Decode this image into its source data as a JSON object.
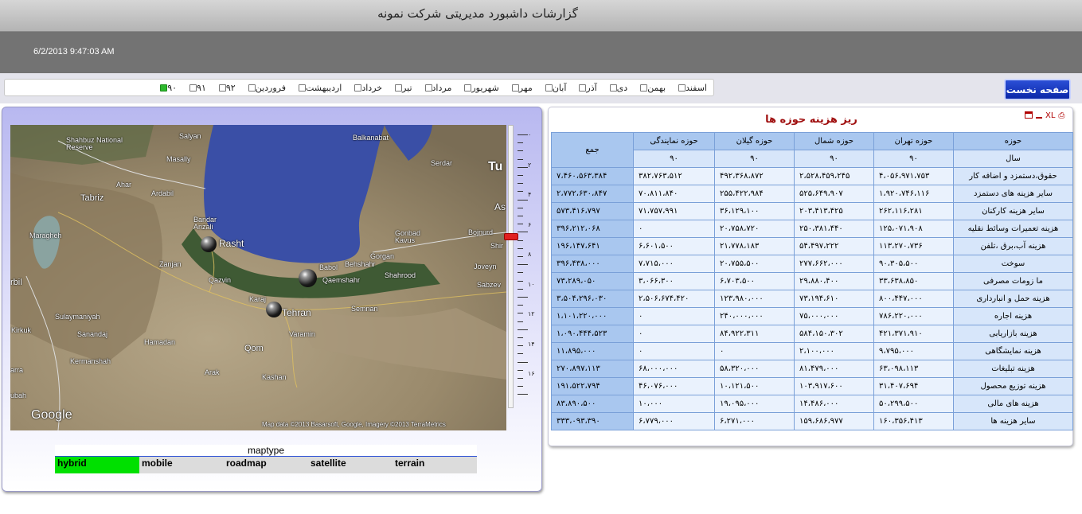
{
  "header": {
    "title": "گزارشات داشبورد مدیریتی شرکت نمونه",
    "datetime": "6/2/2013 9:47:03 AM"
  },
  "toolbar": {
    "home_button": "صفحه نخست",
    "months": [
      {
        "label": "اسفند",
        "checked": false
      },
      {
        "label": "بهمن",
        "checked": false
      },
      {
        "label": "دی",
        "checked": false
      },
      {
        "label": "آذر",
        "checked": false
      },
      {
        "label": "آبان",
        "checked": false
      },
      {
        "label": "مهر",
        "checked": false
      },
      {
        "label": "شهریور",
        "checked": false
      },
      {
        "label": "مرداد",
        "checked": false
      },
      {
        "label": "تیر",
        "checked": false
      },
      {
        "label": "خرداد",
        "checked": false
      },
      {
        "label": "اردیبهشت",
        "checked": false
      },
      {
        "label": "فروردین",
        "checked": false
      },
      {
        "label": "۹۲",
        "checked": false
      },
      {
        "label": "۹۱",
        "checked": false
      },
      {
        "label": "۹۰",
        "checked": true
      }
    ]
  },
  "map": {
    "labels": {
      "shahbuz": "Shahbuz National Reserve",
      "salyan": "Salyan",
      "masally": "Masally",
      "balkanabat": "Balkanabat",
      "serdar": "Serdar",
      "tu": "Tu",
      "ahar": "Ahar",
      "tabriz": "Tabriz",
      "ardabil": "Ardabil",
      "bandar": "Bandar Anzali",
      "rasht": "Rasht",
      "maragheh": "Maragheh",
      "gonbad": "Gonbad Kavus",
      "bojnurd": "Bojnurd",
      "zanjan": "Zanjan",
      "qazvin": "Qazvin",
      "babol": "Babol",
      "behshahr": "Behshahr",
      "gorgan": "Gorgan",
      "qaemshahr": "Qaemshahr",
      "shahrood": "Shahrood",
      "joveyn": "Joveyn",
      "sabzev": "Sabzev",
      "karaj": "Karaj",
      "tehran": "Tehran",
      "semnan": "Semnan",
      "varamin": "Varamin",
      "sulaymaniyah": "Sulaymaniyah",
      "kirkuk": "Kirkuk",
      "sanandaj": "Sanandaj",
      "hamadan": "Hamadan",
      "qom": "Qom",
      "kermanshah": "Kermanshah",
      "arak": "Arak",
      "kashan": "Kashan",
      "as": "As",
      "shir": "Shir",
      "rbil": "rbil",
      "arra": "arra",
      "ubah": "ubah",
      "google": "Google",
      "attribution": "Map data ©2013 Basarsoft, Google, Imagery ©2013 TerraMetrics"
    },
    "zoom_ticks": [
      "۰",
      "۲",
      "۴",
      "۶",
      "۸",
      "۱۰",
      "۱۲",
      "۱۴",
      "۱۶"
    ],
    "maptype": {
      "title": "maptype",
      "options": [
        "hybrid",
        "mobile",
        "roadmap",
        "satellite",
        "terrain"
      ],
      "selected": "hybrid"
    }
  },
  "table": {
    "title": "ریز هزینه حوزه ها",
    "icons": [
      "window-icon",
      "minimize-icon",
      "excel-icon",
      "print-icon"
    ],
    "header_area": "حوزه",
    "header_year": "سال",
    "header_total": "جمع",
    "columns": [
      "حوزه تهران",
      "حوزه شمال",
      "حوزه گیلان",
      "حوزه نمایندگی"
    ],
    "years": [
      "۹۰",
      "۹۰",
      "۹۰",
      "۹۰"
    ],
    "rows": [
      {
        "label": "حقوق،دستمزد و اضافه کار",
        "values": [
          "۴،۰۵۶،۹۷۱،۷۵۳",
          "۲،۵۲۸،۴۵۹،۲۴۵",
          "۴۹۲،۳۶۸،۸۷۲",
          "۳۸۲،۷۶۳،۵۱۲"
        ],
        "total": "۷،۴۶۰،۵۶۳،۳۸۴"
      },
      {
        "label": "سایر هزینه های دستمزد",
        "values": [
          "۱،۹۲۰،۷۴۶،۱۱۶",
          "۵۲۵،۶۴۹،۹۰۷",
          "۲۵۵،۴۲۲،۹۸۴",
          "۷۰،۸۱۱،۸۴۰"
        ],
        "total": "۲،۷۷۲،۶۳۰،۸۴۷"
      },
      {
        "label": "سایر هزینه کارکنان",
        "values": [
          "۲۶۲،۱۱۶،۲۸۱",
          "۲۰۳،۴۱۳،۴۲۵",
          "۳۶،۱۲۹،۱۰۰",
          "۷۱،۷۵۷،۹۹۱"
        ],
        "total": "۵۷۳،۴۱۶،۷۹۷"
      },
      {
        "label": "هزینه تعمیرات وسائط نقلیه",
        "values": [
          "۱۲۵،۰۷۱،۹۰۸",
          "۲۵۰،۳۸۱،۴۴۰",
          "۲۰،۷۵۸،۷۲۰",
          "۰"
        ],
        "total": "۳۹۶،۲۱۲،۰۶۸"
      },
      {
        "label": "هزینه آب،برق ،تلفن",
        "values": [
          "۱۱۳،۲۷۰،۷۳۶",
          "۵۴،۴۹۷،۲۲۲",
          "۲۱،۷۷۸،۱۸۳",
          "۶،۶۰۱،۵۰۰"
        ],
        "total": "۱۹۶،۱۴۷،۶۴۱"
      },
      {
        "label": "سوخت",
        "values": [
          "۹۰،۳۰۵،۵۰۰",
          "۲۷۷،۶۶۲،۰۰۰",
          "۲۰،۷۵۵،۵۰۰",
          "۷،۷۱۵،۰۰۰"
        ],
        "total": "۳۹۶،۴۳۸،۰۰۰"
      },
      {
        "label": "ما زومات مصرفی",
        "values": [
          "۳۳،۶۳۸،۸۵۰",
          "۲۹،۸۸۰،۴۰۰",
          "۶،۷۰۳،۵۰۰",
          "۳،۰۶۶،۳۰۰"
        ],
        "total": "۷۳،۲۸۹،۰۵۰"
      },
      {
        "label": "هزینه حمل و انبارداری",
        "values": [
          "۸۰۰،۴۴۷،۰۰۰",
          "۷۳،۱۹۴،۶۱۰",
          "۱۲۳،۹۸۰،۰۰۰",
          "۲،۵۰۶،۶۷۴،۴۲۰"
        ],
        "total": "۳،۵۰۴،۲۹۶،۰۳۰"
      },
      {
        "label": "هزینه اجاره",
        "values": [
          "۷۸۶،۲۲۰،۰۰۰",
          "۷۵،۰۰۰،۰۰۰",
          "۲۴۰،۰۰۰،۰۰۰",
          "۰"
        ],
        "total": "۱،۱۰۱،۲۲۰،۰۰۰"
      },
      {
        "label": "هزینه بازاریابی",
        "values": [
          "۴۲۱،۳۷۱،۹۱۰",
          "۵۸۴،۱۵۰،۳۰۲",
          "۸۴،۹۲۲،۳۱۱",
          "۰"
        ],
        "total": "۱،۰۹۰،۴۴۴،۵۲۳"
      },
      {
        "label": "هزینه نمایشگاهی",
        "values": [
          "۹،۷۹۵،۰۰۰",
          "۲،۱۰۰،۰۰۰",
          "۰",
          "۰"
        ],
        "total": "۱۱،۸۹۵،۰۰۰"
      },
      {
        "label": "هزینه تبلیغات",
        "values": [
          "۶۳،۰۹۸،۱۱۳",
          "۸۱،۴۷۹،۰۰۰",
          "۵۸،۳۲۰،۰۰۰",
          "۶۸،۰۰۰،۰۰۰"
        ],
        "total": "۲۷۰،۸۹۷،۱۱۳"
      },
      {
        "label": "هزینه توزیع محصول",
        "values": [
          "۳۱،۴۰۷،۶۹۴",
          "۱۰۳،۹۱۷،۶۰۰",
          "۱۰،۱۲۱،۵۰۰",
          "۴۶،۰۷۶،۰۰۰"
        ],
        "total": "۱۹۱،۵۲۲،۷۹۴"
      },
      {
        "label": "هزینه های مالی",
        "values": [
          "۵۰،۲۹۹،۵۰۰",
          "۱۴،۴۸۶،۰۰۰",
          "۱۹،۰۹۵،۰۰۰",
          "۱۰،۰۰۰"
        ],
        "total": "۸۳،۸۹۰،۵۰۰"
      },
      {
        "label": "سایر هزینه ها",
        "values": [
          "۱۶۰،۳۵۶،۴۱۳",
          "۱۵۹،۶۸۶،۹۷۷",
          "۶،۲۷۱،۰۰۰",
          "۶،۷۷۹،۰۰۰"
        ],
        "total": "۳۳۳،۰۹۳،۳۹۰"
      }
    ]
  }
}
